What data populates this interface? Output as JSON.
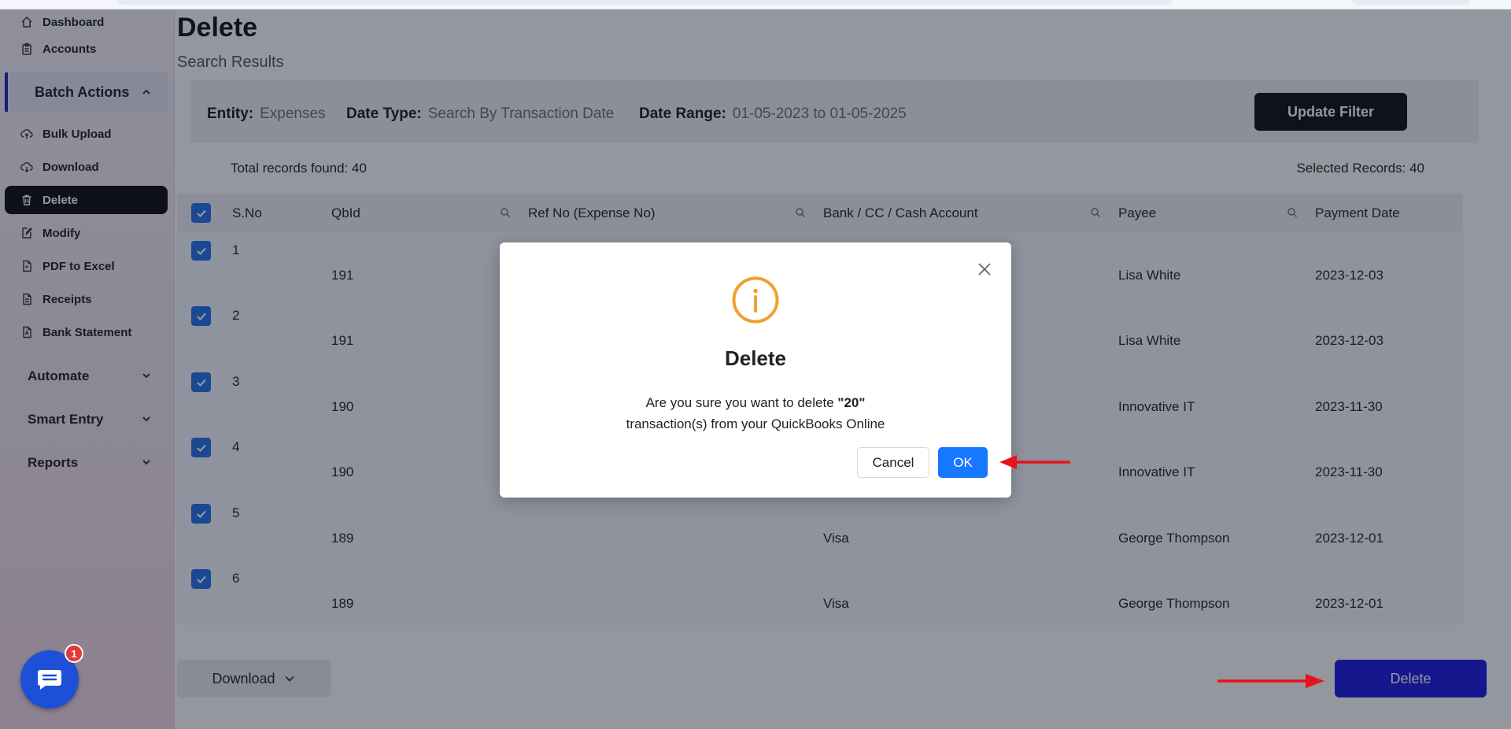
{
  "sidebar": {
    "items_top": [
      {
        "label": "Dashboard",
        "icon": "home-icon"
      },
      {
        "label": "Accounts",
        "icon": "clipboard-icon"
      }
    ],
    "batch_section": "Batch Actions",
    "batch_items": [
      {
        "label": "Bulk Upload",
        "icon": "cloud-upload-icon"
      },
      {
        "label": "Download",
        "icon": "cloud-download-icon"
      },
      {
        "label": "Delete",
        "icon": "trash-icon"
      },
      {
        "label": "Modify",
        "icon": "edit-icon"
      },
      {
        "label": "PDF to Excel",
        "icon": "file-icon"
      },
      {
        "label": "Receipts",
        "icon": "receipt-icon"
      },
      {
        "label": "Bank Statement",
        "icon": "document-icon"
      }
    ],
    "sections": [
      "Automate",
      "Smart Entry",
      "Reports"
    ]
  },
  "page": {
    "title": "Delete",
    "subtitle": "Search Results"
  },
  "filter": {
    "entity_label": "Entity:",
    "entity_value": "Expenses",
    "datetype_label": "Date Type:",
    "datetype_value": "Search By Transaction Date",
    "daterange_label": "Date Range:",
    "daterange_value": "01-05-2023 to 01-05-2025",
    "update_button": "Update Filter"
  },
  "records": {
    "total": "Total records found: 40",
    "selected": "Selected Records: 40"
  },
  "table": {
    "headers": [
      "S.No",
      "QbId",
      "Ref No (Expense No)",
      "Bank / CC / Cash Account",
      "Payee",
      "Payment Date"
    ],
    "rows": [
      {
        "sno": "1",
        "qbid": "191",
        "ref": "",
        "bank": "",
        "payee": "Lisa White",
        "date": "2023-12-03"
      },
      {
        "sno": "2",
        "qbid": "191",
        "ref": "",
        "bank": "",
        "payee": "Lisa White",
        "date": "2023-12-03"
      },
      {
        "sno": "3",
        "qbid": "190",
        "ref": "",
        "bank": "",
        "payee": "Innovative IT",
        "date": "2023-11-30"
      },
      {
        "sno": "4",
        "qbid": "190",
        "ref": "",
        "bank": "",
        "payee": "Innovative IT",
        "date": "2023-11-30"
      },
      {
        "sno": "5",
        "qbid": "189",
        "ref": "",
        "bank": "Visa",
        "payee": "George Thompson",
        "date": "2023-12-01"
      },
      {
        "sno": "6",
        "qbid": "189",
        "ref": "",
        "bank": "Visa",
        "payee": "George Thompson",
        "date": "2023-12-01"
      }
    ]
  },
  "footer": {
    "download_button": "Download",
    "delete_button": "Delete"
  },
  "chat": {
    "badge": "1"
  },
  "modal": {
    "title": "Delete",
    "msg_prefix": "Are you sure you want to delete ",
    "msg_count": "\"20\"",
    "msg_suffix": "transaction(s) from your QuickBooks Online",
    "cancel": "Cancel",
    "ok": "OK"
  },
  "colors": {
    "accent": "#1677ff",
    "primary_dark": "#0b0c14",
    "delete": "#1616e0",
    "info": "#f0a030",
    "annotation_arrow": "#e8121b"
  }
}
